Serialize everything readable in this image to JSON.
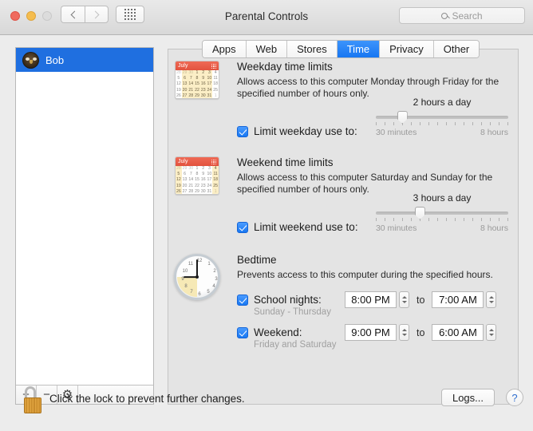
{
  "window": {
    "title": "Parental Controls",
    "traffic_lights": [
      "close",
      "minimize",
      "zoom"
    ]
  },
  "toolbar": {
    "back_icon": "chevron-left-icon",
    "forward_icon": "chevron-right-icon",
    "grid_icon": "show-all-grid-icon",
    "search_placeholder": "Search",
    "search_value": "",
    "search_icon": "search-icon"
  },
  "sidebar": {
    "users": [
      {
        "name": "Bob",
        "selected": true,
        "avatar": "owl-avatar-icon"
      }
    ],
    "toolbar": {
      "add_label": "+",
      "remove_label": "−",
      "settings_icon": "gear-icon"
    }
  },
  "tabs": [
    {
      "label": "Apps",
      "active": false
    },
    {
      "label": "Web",
      "active": false
    },
    {
      "label": "Stores",
      "active": false
    },
    {
      "label": "Time",
      "active": true
    },
    {
      "label": "Privacy",
      "active": false
    },
    {
      "label": "Other",
      "active": false
    }
  ],
  "weekday": {
    "icon": "calendar-weekday-icon",
    "month": "July",
    "title": "Weekday time limits",
    "description": "Allows access to this computer Monday through Friday for the specified number of hours only.",
    "checkbox_label": "Limit weekday use to:",
    "checked": true,
    "slider": {
      "value_label": "2 hours a day",
      "min_label": "30 minutes",
      "max_label": "8 hours",
      "min": 0.5,
      "max": 8,
      "value": 2,
      "ticks": 16
    }
  },
  "weekend": {
    "icon": "calendar-weekend-icon",
    "month": "July",
    "title": "Weekend time limits",
    "description": "Allows access to this computer Saturday and Sunday for the specified number of hours only.",
    "checkbox_label": "Limit weekend use to:",
    "checked": true,
    "slider": {
      "value_label": "3 hours a day",
      "min_label": "30 minutes",
      "max_label": "8 hours",
      "min": 0.5,
      "max": 8,
      "value": 3,
      "ticks": 16
    }
  },
  "bedtime": {
    "icon": "clock-icon",
    "title": "Bedtime",
    "description": "Prevents access to this computer during the specified hours.",
    "to_label": "to",
    "rows": [
      {
        "checkbox_label": "School nights:",
        "sublabel": "Sunday - Thursday",
        "checked": true,
        "start": "8:00 PM",
        "end": "7:00 AM"
      },
      {
        "checkbox_label": "Weekend:",
        "sublabel": "Friday and Saturday",
        "checked": true,
        "start": "9:00 PM",
        "end": "6:00 AM"
      }
    ]
  },
  "footer": {
    "lock_icon": "unlocked-padlock-icon",
    "lock_text": "Click the lock to prevent further changes.",
    "logs_label": "Logs...",
    "help_label": "?"
  },
  "calendar_weekday_grid": [
    {
      "d": "28",
      "dim": true,
      "hl": false
    },
    {
      "d": "29",
      "dim": true,
      "hl": true
    },
    {
      "d": "30",
      "dim": true,
      "hl": true
    },
    {
      "d": "1",
      "dim": false,
      "hl": true
    },
    {
      "d": "2",
      "dim": false,
      "hl": true
    },
    {
      "d": "3",
      "dim": false,
      "hl": true
    },
    {
      "d": "4",
      "dim": false,
      "hl": false
    },
    {
      "d": "5",
      "dim": false,
      "hl": false
    },
    {
      "d": "6",
      "dim": false,
      "hl": true
    },
    {
      "d": "7",
      "dim": false,
      "hl": true
    },
    {
      "d": "8",
      "dim": false,
      "hl": true
    },
    {
      "d": "9",
      "dim": false,
      "hl": true
    },
    {
      "d": "10",
      "dim": false,
      "hl": true
    },
    {
      "d": "11",
      "dim": false,
      "hl": false
    },
    {
      "d": "12",
      "dim": false,
      "hl": false
    },
    {
      "d": "13",
      "dim": false,
      "hl": true
    },
    {
      "d": "14",
      "dim": false,
      "hl": true
    },
    {
      "d": "15",
      "dim": false,
      "hl": true
    },
    {
      "d": "16",
      "dim": false,
      "hl": true
    },
    {
      "d": "17",
      "dim": false,
      "hl": true
    },
    {
      "d": "18",
      "dim": false,
      "hl": false
    },
    {
      "d": "19",
      "dim": false,
      "hl": false
    },
    {
      "d": "20",
      "dim": false,
      "hl": true
    },
    {
      "d": "21",
      "dim": false,
      "hl": true
    },
    {
      "d": "22",
      "dim": false,
      "hl": true
    },
    {
      "d": "23",
      "dim": false,
      "hl": true
    },
    {
      "d": "24",
      "dim": false,
      "hl": true
    },
    {
      "d": "25",
      "dim": false,
      "hl": false
    },
    {
      "d": "26",
      "dim": false,
      "hl": false
    },
    {
      "d": "27",
      "dim": false,
      "hl": true
    },
    {
      "d": "28",
      "dim": false,
      "hl": true
    },
    {
      "d": "29",
      "dim": false,
      "hl": true
    },
    {
      "d": "30",
      "dim": false,
      "hl": true
    },
    {
      "d": "31",
      "dim": false,
      "hl": true
    },
    {
      "d": "1",
      "dim": true,
      "hl": false
    }
  ],
  "calendar_weekend_grid": [
    {
      "d": "28",
      "dim": true,
      "hl": true
    },
    {
      "d": "29",
      "dim": true,
      "hl": false
    },
    {
      "d": "30",
      "dim": true,
      "hl": false
    },
    {
      "d": "1",
      "dim": false,
      "hl": false
    },
    {
      "d": "2",
      "dim": false,
      "hl": false
    },
    {
      "d": "3",
      "dim": false,
      "hl": false
    },
    {
      "d": "4",
      "dim": false,
      "hl": true
    },
    {
      "d": "5",
      "dim": false,
      "hl": true
    },
    {
      "d": "6",
      "dim": false,
      "hl": false
    },
    {
      "d": "7",
      "dim": false,
      "hl": false
    },
    {
      "d": "8",
      "dim": false,
      "hl": false
    },
    {
      "d": "9",
      "dim": false,
      "hl": false
    },
    {
      "d": "10",
      "dim": false,
      "hl": false
    },
    {
      "d": "11",
      "dim": false,
      "hl": true
    },
    {
      "d": "12",
      "dim": false,
      "hl": true
    },
    {
      "d": "13",
      "dim": false,
      "hl": false
    },
    {
      "d": "14",
      "dim": false,
      "hl": false
    },
    {
      "d": "15",
      "dim": false,
      "hl": false
    },
    {
      "d": "16",
      "dim": false,
      "hl": false
    },
    {
      "d": "17",
      "dim": false,
      "hl": false
    },
    {
      "d": "18",
      "dim": false,
      "hl": true
    },
    {
      "d": "19",
      "dim": false,
      "hl": true
    },
    {
      "d": "20",
      "dim": false,
      "hl": false
    },
    {
      "d": "21",
      "dim": false,
      "hl": false
    },
    {
      "d": "22",
      "dim": false,
      "hl": false
    },
    {
      "d": "23",
      "dim": false,
      "hl": false
    },
    {
      "d": "24",
      "dim": false,
      "hl": false
    },
    {
      "d": "25",
      "dim": false,
      "hl": true
    },
    {
      "d": "26",
      "dim": false,
      "hl": true
    },
    {
      "d": "27",
      "dim": false,
      "hl": false
    },
    {
      "d": "28",
      "dim": false,
      "hl": false
    },
    {
      "d": "29",
      "dim": false,
      "hl": false
    },
    {
      "d": "30",
      "dim": false,
      "hl": false
    },
    {
      "d": "31",
      "dim": false,
      "hl": false
    },
    {
      "d": "1",
      "dim": true,
      "hl": true
    }
  ],
  "clock": {
    "hour": 9,
    "minute": 0
  },
  "colors": {
    "accent_blue": "#1877f2",
    "selection_blue": "#1f6fe0",
    "calendar_red": "#e2523e",
    "calendar_highlight": "#fbeec6",
    "lock_gold": "#d5962f",
    "panel_bg": "#e4e4e4",
    "window_bg": "#ececec"
  }
}
